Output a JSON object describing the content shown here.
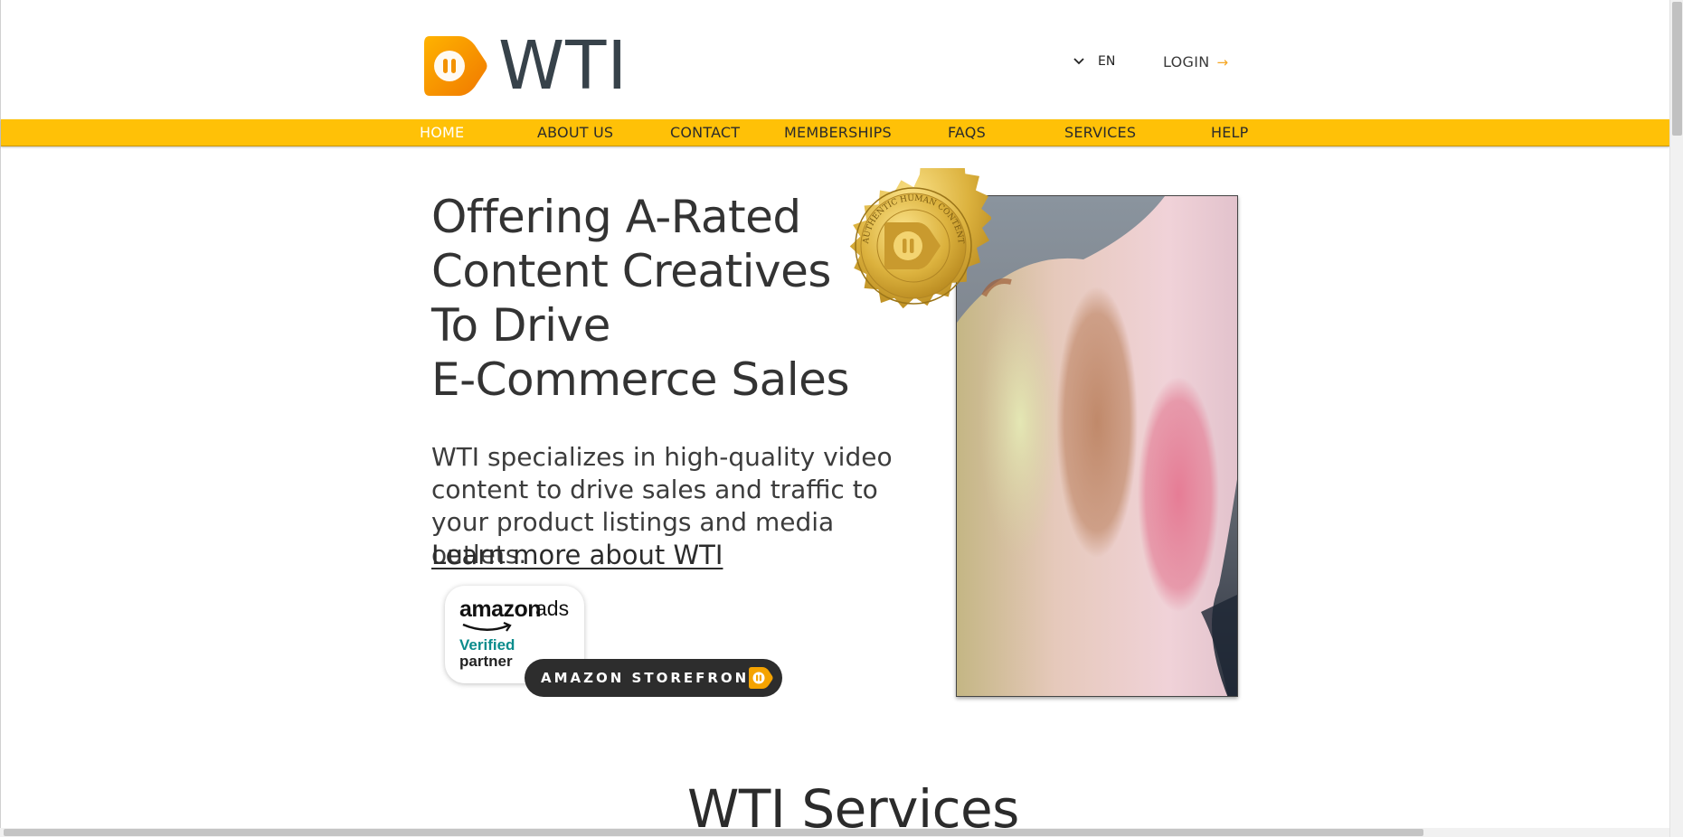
{
  "header": {
    "logo_text": "WTI",
    "language": "EN",
    "login_label": "LOGIN",
    "accent_color": "#ffc107"
  },
  "nav": {
    "items": [
      {
        "label": "HOME",
        "active": true
      },
      {
        "label": "ABOUT US",
        "active": false
      },
      {
        "label": "CONTACT",
        "active": false
      },
      {
        "label": "MEMBERSHIPS",
        "active": false
      },
      {
        "label": "FAQS",
        "active": false
      },
      {
        "label": "SERVICES",
        "active": false
      },
      {
        "label": "HELP",
        "active": false
      }
    ]
  },
  "hero": {
    "headline_lines": [
      "Offering A-Rated",
      "Content Creatives",
      "To Drive",
      "E-Commerce Sales"
    ],
    "subtext": "WTI specializes in high-quality video content to drive sales and traffic to your product listings and media outlets.",
    "learn_more": "Learn more about WTI",
    "badge": {
      "amazon": "amazon",
      "ads": "ads",
      "verified": "Verified",
      "partner": "partner"
    },
    "storefront_button": "AMAZON STOREFRONT",
    "seal_text": "AUTHENTIC HUMAN CONTENT"
  },
  "services": {
    "title": "WTI Services"
  },
  "icons": [
    "logo-play-icon",
    "chevron-down-icon",
    "arrow-right-icon",
    "play-pause-icon",
    "gold-seal-icon"
  ]
}
